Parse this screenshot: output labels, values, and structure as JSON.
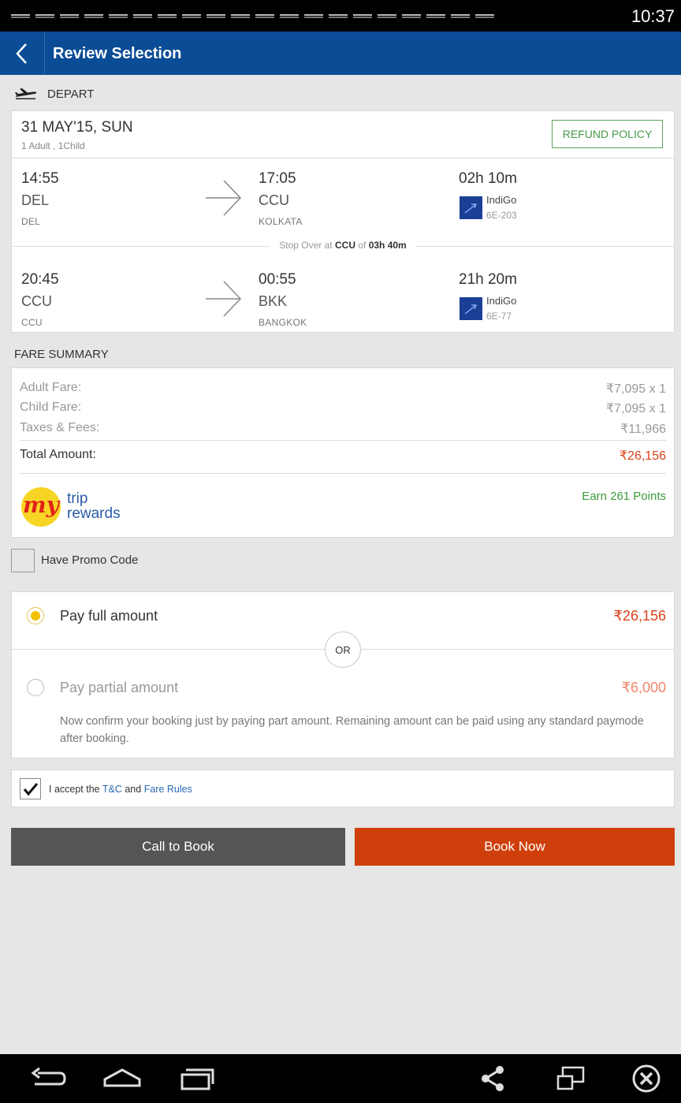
{
  "status_bar": {
    "time": "10:37"
  },
  "app_bar": {
    "title": "Review Selection"
  },
  "depart_label": "DEPART",
  "flight": {
    "date": "31 MAY'15, SUN",
    "pax": "1 Adult , 1Child",
    "refund_label": "REFUND POLICY",
    "segments": [
      {
        "dep_time": "14:55",
        "dep_code": "DEL",
        "dep_city": "DEL",
        "arr_time": "17:05",
        "arr_code": "CCU",
        "arr_city": "KOLKATA",
        "duration": "02h 10m",
        "airline": "IndiGo",
        "flight_no": "6E-203"
      },
      {
        "dep_time": "20:45",
        "dep_code": "CCU",
        "dep_city": "CCU",
        "arr_time": "00:55",
        "arr_code": "BKK",
        "arr_city": "BANGKOK",
        "duration": "21h 20m",
        "airline": "IndiGo",
        "flight_no": "6E-77"
      }
    ],
    "stopover": {
      "prefix": "Stop Over at",
      "place": "CCU",
      "of": "of",
      "duration": "03h 40m"
    }
  },
  "fare_summary": {
    "title": "FARE SUMMARY",
    "rows": [
      {
        "label": "Adult Fare:",
        "value": "₹7,095 x 1"
      },
      {
        "label": "Child Fare:",
        "value": "₹7,095 x 1"
      },
      {
        "label": "Taxes & Fees:",
        "value": "₹11,966"
      }
    ],
    "total_label": "Total Amount:",
    "total_value": "₹26,156",
    "rewards_logo": {
      "my": "my",
      "trip": "trip",
      "rewards": "rewards"
    },
    "earn_points": "Earn 261 Points"
  },
  "promo": {
    "label": "Have Promo Code"
  },
  "payment": {
    "full_label": "Pay full amount",
    "full_amount": "₹26,156",
    "or_label": "OR",
    "partial_label": "Pay partial amount",
    "partial_amount": "₹6,000",
    "partial_desc": "Now confirm your booking just by paying part amount. Remaining amount can be paid using any standard paymode after booking."
  },
  "accept": {
    "prefix": "I accept the",
    "tc": "T&C",
    "and": "and",
    "fare_rules": "Fare Rules"
  },
  "buttons": {
    "call": "Call to Book",
    "book": "Book Now"
  },
  "colors": {
    "appbar": "#0b4c96",
    "book": "#cf3f0b",
    "call": "#555555",
    "accent_green": "#3b9c3b",
    "price_red": "#d9431b"
  }
}
